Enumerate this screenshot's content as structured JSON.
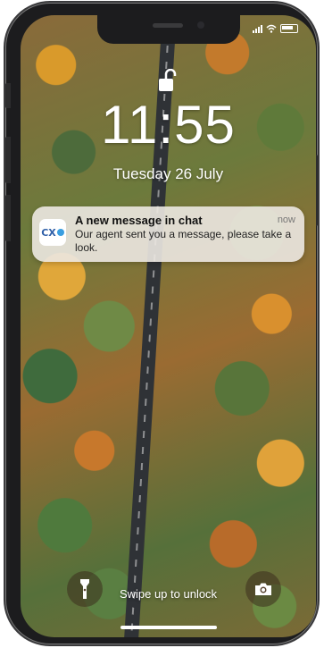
{
  "lock_screen": {
    "time": "11:55",
    "date": "Tuesday 26 July"
  },
  "notification": {
    "app_icon_label": "CX",
    "title": "A new message in chat",
    "time": "now",
    "body": "Our agent sent you a message, please take a look."
  },
  "bottom": {
    "swipe_text": "Swipe up to unlock"
  },
  "icons": {
    "lock": "unlocked-padlock-icon",
    "flashlight": "flashlight-icon",
    "camera": "camera-icon",
    "signal": "cellular-signal-icon",
    "wifi": "wifi-icon",
    "battery": "battery-icon"
  }
}
